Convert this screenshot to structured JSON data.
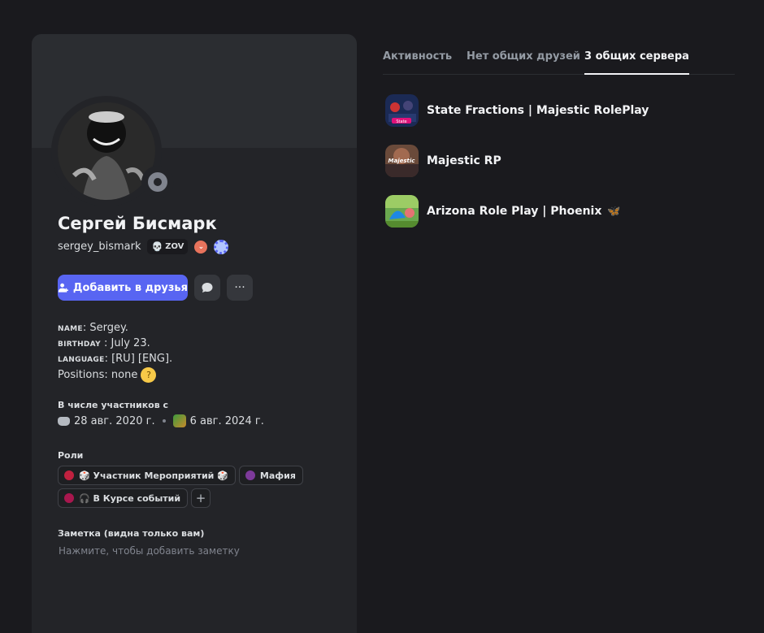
{
  "profile": {
    "display_name": "Сергей Бисмарк",
    "username": "sergey_bismark",
    "tag": "ZOV",
    "add_friend_label": "Добавить в друзья",
    "more_label": "···"
  },
  "bio": {
    "name_key": "NAME",
    "name_value": ": Sergey.",
    "birthday_key": "BIRTHDAY",
    "birthday_value": " : July 23.",
    "language_key": "LANGUAGE",
    "language_value": ": [RU] [ENG].",
    "positions": "Positions: none"
  },
  "member_since": {
    "title": "В числе участников с",
    "discord_date": "28 авг. 2020 г.",
    "server_date": "6 авг. 2024 г."
  },
  "roles": {
    "title": "Роли",
    "items": [
      {
        "label": "🎲 Участник Мероприятий 🎲",
        "color": "#c0213f"
      },
      {
        "label": "Мафия",
        "color": "#7d3a9a"
      },
      {
        "label": "🎧 В Курсе событий",
        "color": "#a8174e"
      }
    ],
    "add_label": "+"
  },
  "note": {
    "title": "Заметка (видна только вам)",
    "placeholder": "Нажмите, чтобы добавить заметку"
  },
  "tabs": [
    {
      "label": "Активность",
      "active": false
    },
    {
      "label": "Нет общих друзей",
      "active": false
    },
    {
      "label": "3 общих сервера",
      "active": true
    }
  ],
  "servers": [
    {
      "name": "State Fractions | Majestic RolePlay",
      "icon_text": "State"
    },
    {
      "name": "Majestic RP",
      "icon_text": "Majestic"
    },
    {
      "name": "Arizona Role Play | Phoenix",
      "suffix": "🦋"
    }
  ],
  "colors": {
    "accent": "#5865f2",
    "background": "#1a1a1e",
    "card": "#232428",
    "status_offline": "#80848e"
  }
}
